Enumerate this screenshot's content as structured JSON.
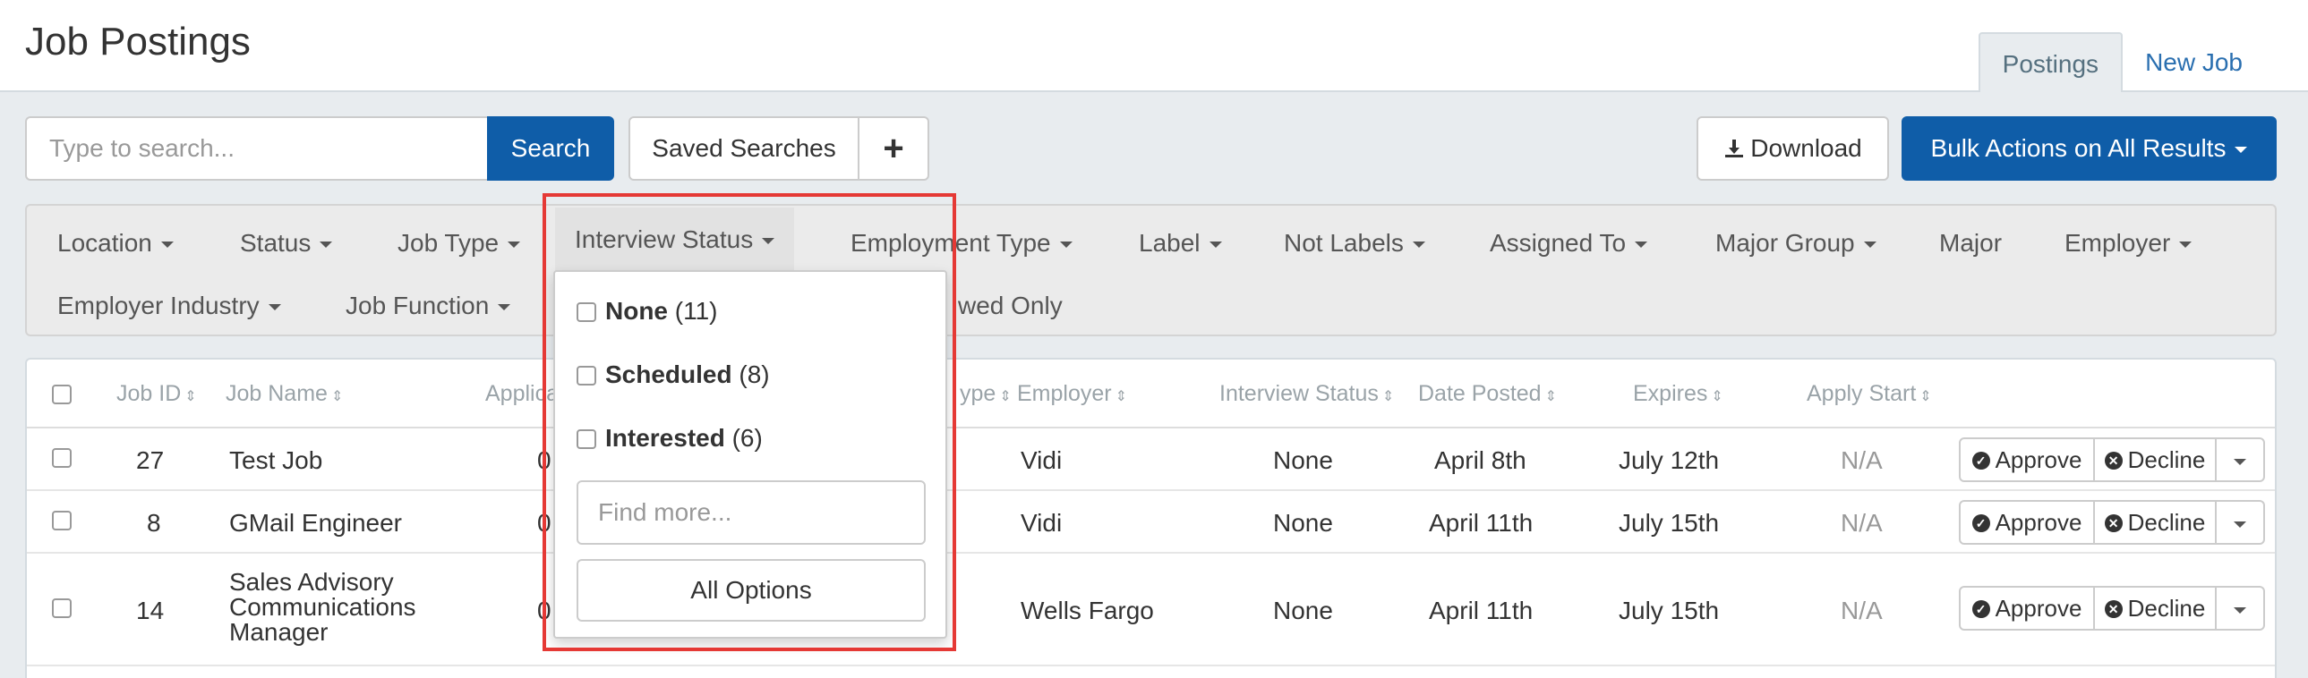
{
  "header": {
    "title": "Job Postings",
    "tabs": [
      {
        "label": "Postings",
        "active": true
      },
      {
        "label": "New Job",
        "active": false
      }
    ]
  },
  "toolbar": {
    "search_placeholder": "Type to search...",
    "search_label": "Search",
    "saved_searches_label": "Saved Searches",
    "add_label": "+",
    "download_label": "Download",
    "bulk_actions_label": "Bulk Actions on All Results"
  },
  "filters": {
    "row1": [
      "Location",
      "Status",
      "Job Type",
      "Interview Status",
      "Employment Type",
      "Label",
      "Not Labels",
      "Assigned To",
      "Major Group",
      "Major",
      "Employer"
    ],
    "row2": [
      "Employer Industry",
      "Job Function"
    ],
    "partial_text": "wed Only"
  },
  "interview_status_dropdown": {
    "options": [
      {
        "label": "None",
        "count": "(11)"
      },
      {
        "label": "Scheduled",
        "count": "(8)"
      },
      {
        "label": "Interested",
        "count": "(6)"
      }
    ],
    "find_placeholder": "Find more...",
    "all_options_label": "All Options"
  },
  "table": {
    "columns": [
      "Job ID",
      "Job Name",
      "Applica",
      "ype",
      "Employer",
      "Interview Status",
      "Date Posted",
      "Expires",
      "Apply Start"
    ],
    "rows": [
      {
        "id": "27",
        "name": "Test Job",
        "apps": "0",
        "employer": "Vidi",
        "interview_status": "None",
        "date_posted": "April 8th",
        "expires": "July 12th",
        "apply_start": "N/A"
      },
      {
        "id": "8",
        "name": "GMail Engineer",
        "apps": "0",
        "employer": "Vidi",
        "interview_status": "None",
        "date_posted": "April 11th",
        "expires": "July 15th",
        "apply_start": "N/A"
      },
      {
        "id": "14",
        "name_lines": [
          "Sales Advisory",
          "Communications",
          "Manager"
        ],
        "apps": "0",
        "employer": "Wells Fargo",
        "interview_status": "None",
        "date_posted": "April 11th",
        "expires": "July 15th",
        "apply_start": "N/A"
      }
    ],
    "approve_label": "Approve",
    "decline_label": "Decline"
  },
  "colors": {
    "primary": "#0f5da8",
    "highlight": "#e53935",
    "background": "#e8ecef"
  }
}
